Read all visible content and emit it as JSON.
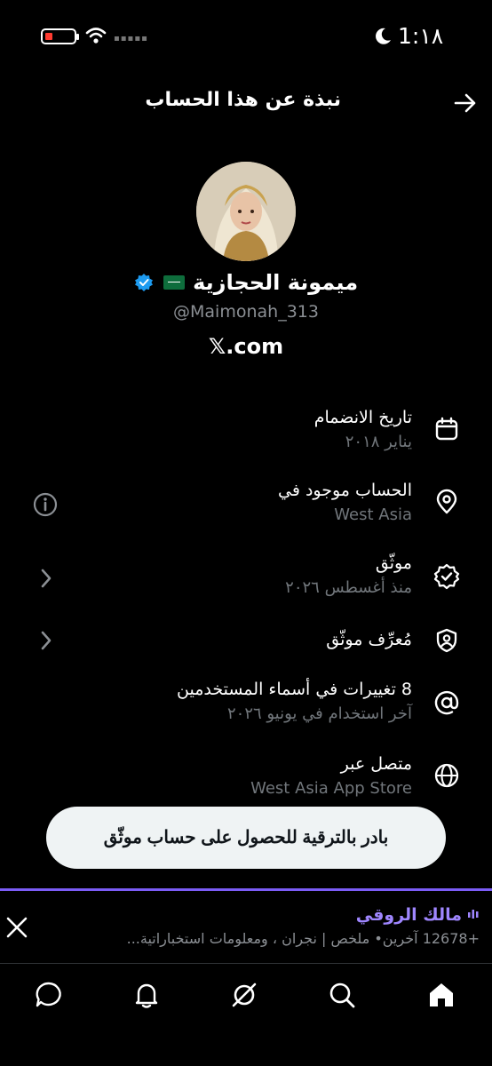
{
  "status_bar": {
    "time": "1:١٨",
    "icons": [
      "battery-low-icon",
      "wifi-icon",
      "signal-dots-icon",
      "moon-icon"
    ],
    "battery_color": "#ff3b30"
  },
  "header": {
    "title": "نبذة عن هذا الحساب",
    "back_icon": "arrow-right-icon"
  },
  "profile": {
    "name": "ميمونة الحجازية",
    "handle": "@Maimonah_313",
    "site": "𝕏.com",
    "flag": "saudi-flag",
    "verified_color": "#1d9bf0"
  },
  "rows": [
    {
      "title": "تاريخ الانضمام",
      "subtitle": "يناير ٢٠١٨",
      "icon": "calendar-icon"
    },
    {
      "title": "الحساب موجود في",
      "subtitle": "West Asia",
      "icon": "location-pin-icon",
      "left_icon": "info-icon"
    },
    {
      "title": "موثّق",
      "subtitle": "منذ أغسطس ٢٠٢٦",
      "icon": "verified-badge-icon",
      "left_icon": "chevron-left-icon"
    },
    {
      "title": "مُعرِّف موثّق",
      "icon": "shield-person-icon",
      "left_icon": "chevron-left-icon"
    },
    {
      "title": "8 تغييرات في أسماء المستخدمين",
      "subtitle": "آخر استخدام في يونيو ٢٠٢٦",
      "icon": "at-icon"
    },
    {
      "title": "متصل عبر",
      "subtitle": "West Asia App Store",
      "icon": "globe-icon"
    }
  ],
  "upgrade_button": "بادر بالترقية للحصول على حساب موثّق",
  "space_banner": {
    "host": "مالك الروقي",
    "description": "+12678 آخرين• ملخص | نجران ، ومعلومات استخباراتية...",
    "accent": "#7b5cf6"
  },
  "bottom_nav": [
    "home-icon",
    "search-icon",
    "grok-icon",
    "notifications-icon",
    "messages-icon"
  ]
}
